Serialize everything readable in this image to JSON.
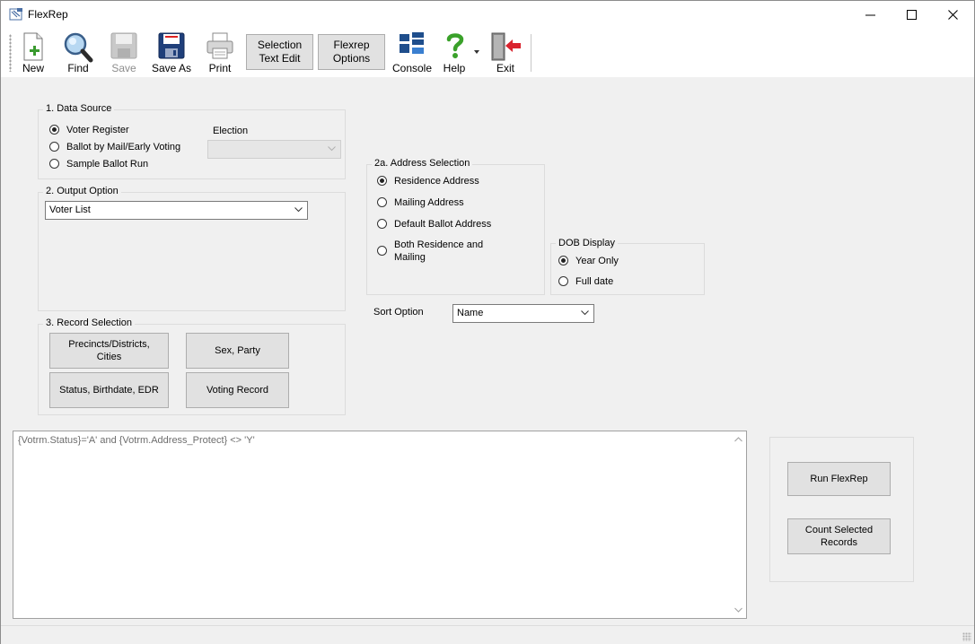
{
  "window": {
    "title": "FlexRep"
  },
  "toolbar": {
    "new": {
      "label": "New",
      "icon": "new-document-icon"
    },
    "find": {
      "label": "Find",
      "icon": "magnifier-icon"
    },
    "save": {
      "label": "Save",
      "icon": "floppy-disk-icon",
      "enabled": false
    },
    "save_as": {
      "label": "Save As",
      "icon": "floppy-disk-icon"
    },
    "print": {
      "label": "Print",
      "icon": "printer-icon"
    },
    "selection_text_edit": {
      "line1": "Selection",
      "line2": "Text Edit"
    },
    "flexrep_options": {
      "line1": "Flexrep",
      "line2": "Options"
    },
    "console": {
      "label": "Console",
      "icon": "console-icon"
    },
    "help": {
      "label": "Help",
      "icon": "question-mark-icon"
    },
    "exit": {
      "label": "Exit",
      "icon": "exit-door-icon"
    }
  },
  "data_source": {
    "title": "1.  Data Source",
    "options": [
      "Voter Register",
      "Ballot by Mail/Early Voting",
      "Sample Ballot Run"
    ],
    "selected": 0,
    "election_label": "Election",
    "election_value": ""
  },
  "output_option": {
    "title": "2.  Output Option",
    "value": "Voter List"
  },
  "address_selection": {
    "title": "2a.  Address Selection",
    "options": [
      "Residence Address",
      "Mailing Address",
      "Default Ballot Address",
      "Both Residence and",
      "Mailing"
    ],
    "selected": 0
  },
  "dob_display": {
    "title": "DOB Display",
    "options": [
      "Year Only",
      "Full date"
    ],
    "selected": 0
  },
  "sort_option": {
    "label": "Sort Option",
    "value": "Name"
  },
  "record_selection": {
    "title": "3.  Record Selection",
    "precincts_line1": "Precincts/Districts,",
    "precincts_line2": "Cities",
    "sex_party": "Sex, Party",
    "status_birthdate": "Status, Birthdate, EDR",
    "voting_record": "Voting Record"
  },
  "selection_text": "{Votrm.Status}='A' and {Votrm.Address_Protect} <> 'Y'",
  "actions": {
    "run_flexrep": "Run FlexRep",
    "count_line1": "Count Selected",
    "count_line2": "Records"
  },
  "colors": {
    "accent_blue": "#1f4e8c",
    "button_face": "#e1e1e1",
    "exit_red": "#d9232e"
  }
}
